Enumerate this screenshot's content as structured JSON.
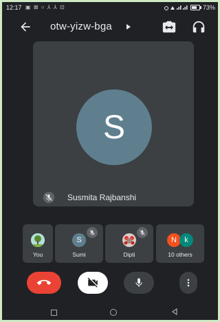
{
  "status_bar": {
    "time": "12:17",
    "notifications": "▣ ⊠ ○ ⅄ ⅄ ⊡",
    "battery": "73%"
  },
  "header": {
    "meeting_code": "otw-yizw-bga"
  },
  "main_participant": {
    "initial": "S",
    "name": "Susmita Rajbanshi",
    "avatar_color": "#5f7f8e"
  },
  "participants": [
    {
      "label": "You",
      "initial": ""
    },
    {
      "label": "Sumi",
      "initial": "S"
    },
    {
      "label": "Dipti",
      "initial": ""
    },
    {
      "label": "10 others",
      "initials": [
        "N",
        "k"
      ]
    }
  ],
  "colors": {
    "end_call": "#ea4335",
    "tile": "#3c4043",
    "background": "#202124",
    "avatar_n": "#f4511e",
    "avatar_k": "#00897b"
  },
  "icons": {
    "back": "arrow-left-icon",
    "switch_camera": "camera-switch-icon",
    "audio": "headphone-icon",
    "end_call": "phone-hangup-icon",
    "camera": "video-off-icon",
    "mic": "mic-icon",
    "more": "more-vert-icon"
  }
}
